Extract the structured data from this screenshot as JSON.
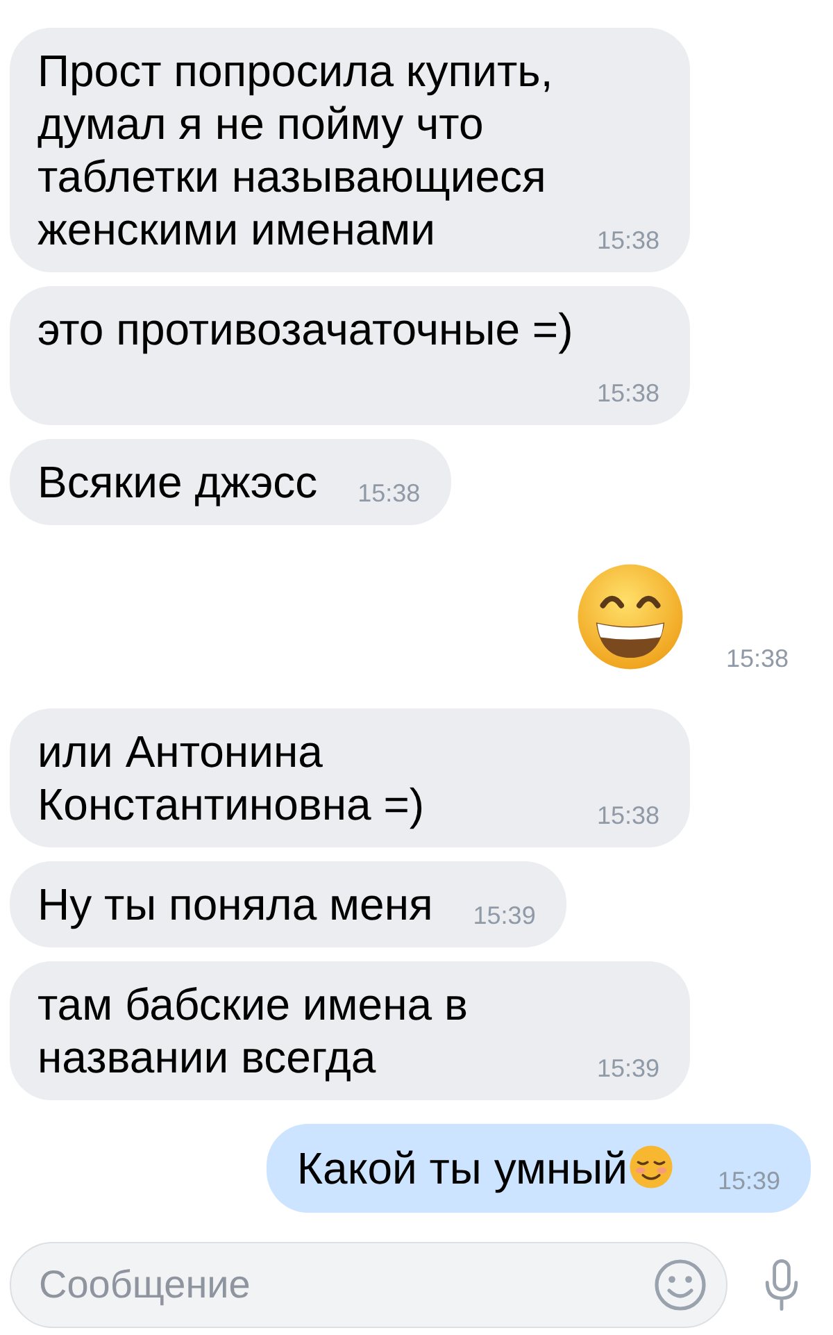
{
  "messages": [
    {
      "kind": "incoming",
      "text": "Прост попросила купить, думал я не пойму что таблетки называющиеся женскими именами",
      "time": "15:38"
    },
    {
      "kind": "incoming",
      "text": "это противозачаточные =)",
      "time": "15:38"
    },
    {
      "kind": "incoming",
      "text": "Всякие джэсс",
      "time": "15:38"
    },
    {
      "kind": "emoji",
      "time": "15:38"
    },
    {
      "kind": "incoming",
      "text": "или Антонина Константиновна =)",
      "time": "15:38"
    },
    {
      "kind": "incoming",
      "text": "Ну ты поняла меня",
      "time": "15:39"
    },
    {
      "kind": "incoming",
      "text": "там бабские имена в названии всегда",
      "time": "15:39"
    },
    {
      "kind": "outgoing",
      "text": "Какой ты умный",
      "time": "15:39"
    }
  ],
  "composer": {
    "placeholder": "Сообщение"
  }
}
